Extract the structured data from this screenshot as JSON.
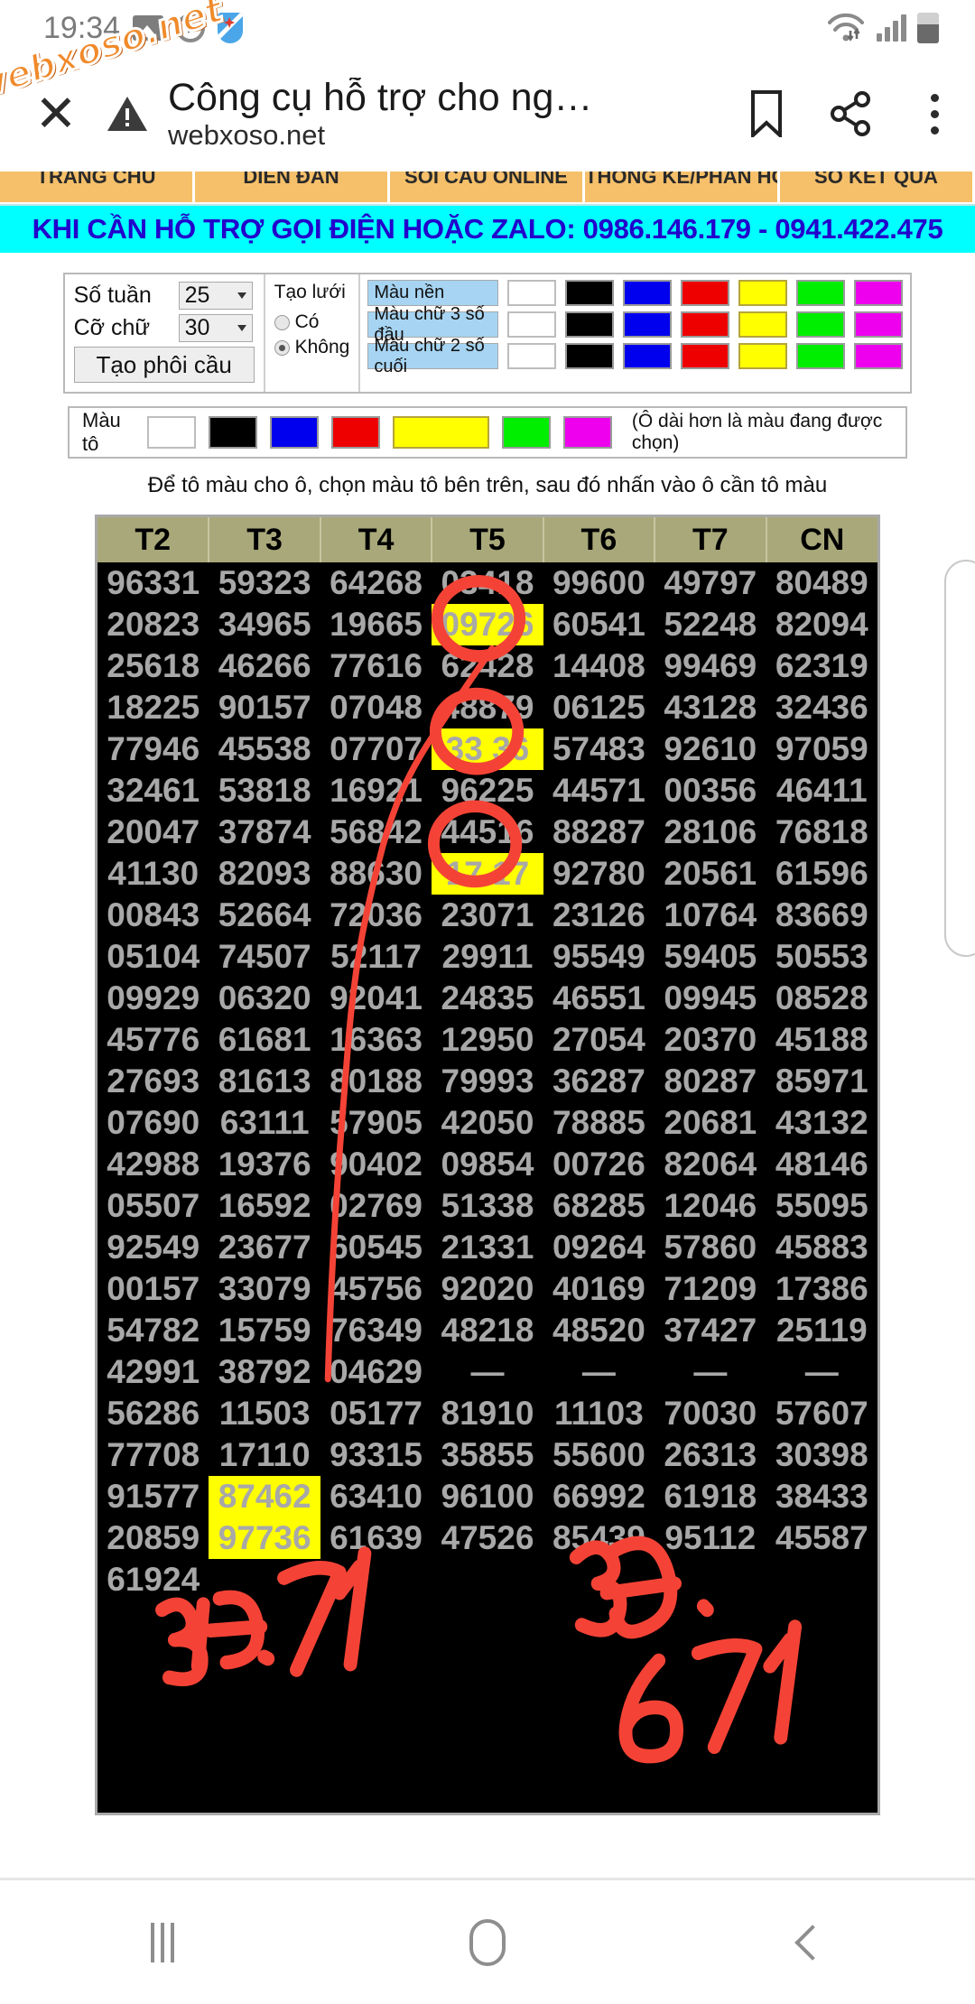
{
  "status_bar": {
    "time": "19:34",
    "left_icons": [
      "image-icon",
      "media-player-icon",
      "shield-icon"
    ],
    "right_icons": [
      "wifi-icon",
      "signal-icon",
      "battery-icon"
    ]
  },
  "browser": {
    "close_label": "✕",
    "security_icon": "warning-triangle-icon",
    "title": "Công cụ hỗ trợ cho ng…",
    "url": "webxoso.net",
    "bookmark_icon": "bookmark-icon",
    "share_icon": "share-icon",
    "more_icon": "more-vertical-icon",
    "watermark": "webxoso.net"
  },
  "site_nav": {
    "items": [
      "TRANG CHỦ",
      "DIỄN ĐÀN",
      "SOI CẦU ONLINE",
      "THỐNG KÊ/PHẢN HỒI",
      "SỔ KẾT QUẢ"
    ]
  },
  "banner": {
    "text": "KHI CẦN HỖ TRỢ GỌI ĐIỆN HOẶC ZALO: 0986.146.179 - 0941.422.475"
  },
  "controls": {
    "weeks_label": "Số tuần",
    "weeks_value": "25",
    "fontsize_label": "Cỡ chữ",
    "fontsize_value": "30",
    "create_button": "Tạo phôi cầu",
    "grid_title": "Tạo lưới",
    "grid_yes": "Có",
    "grid_no": "Không",
    "grid_selected": "Không"
  },
  "color_rows": [
    {
      "label": "Màu nền"
    },
    {
      "label": "Màu chữ 3 số đầu"
    },
    {
      "label": "Màu chữ 2 số cuối"
    }
  ],
  "palette": [
    "#ffffff",
    "#000000",
    "#0000ee",
    "#ee0000",
    "#ffff00",
    "#00ee00",
    "#ee00ee"
  ],
  "fill_row": {
    "label": "Màu tô",
    "note": "(Ô dài hơn là màu đang được chọn)",
    "selected_color": "#ffff00"
  },
  "hint": "Để tô màu cho ô, chọn màu tô bên trên, sau đó nhấn vào ô cần tô màu",
  "table": {
    "headers": [
      "T2",
      "T3",
      "T4",
      "T5",
      "T6",
      "T7",
      "CN"
    ],
    "rows": [
      [
        "96331",
        "59323",
        "64268",
        "03418",
        "99600",
        "49797",
        "80489"
      ],
      [
        "20823",
        "34965",
        "19665",
        "09726",
        "60541",
        "52248",
        "82094"
      ],
      [
        "25618",
        "46266",
        "77616",
        "62428",
        "14408",
        "99469",
        "62319"
      ],
      [
        "18225",
        "90157",
        "07048",
        "48879",
        "06125",
        "43128",
        "32436"
      ],
      [
        "77946",
        "45538",
        "07707",
        "33 36",
        "57483",
        "92610",
        "97059"
      ],
      [
        "32461",
        "53818",
        "16921",
        "96225",
        "44571",
        "00356",
        "46411"
      ],
      [
        "20047",
        "37874",
        "56842",
        "44516",
        "88287",
        "28106",
        "76818"
      ],
      [
        "41130",
        "82093",
        "88630",
        "17 17",
        "92780",
        "20561",
        "61596"
      ],
      [
        "00843",
        "52664",
        "72036",
        "23071",
        "23126",
        "10764",
        "83669"
      ],
      [
        "05104",
        "74507",
        "52117",
        "29911",
        "95549",
        "59405",
        "50553"
      ],
      [
        "09929",
        "06320",
        "92041",
        "24835",
        "46551",
        "09945",
        "08528"
      ],
      [
        "45776",
        "61681",
        "16363",
        "12950",
        "27054",
        "20370",
        "45188"
      ],
      [
        "27693",
        "81613",
        "80188",
        "79993",
        "36287",
        "80287",
        "85971"
      ],
      [
        "07690",
        "63111",
        "57905",
        "42050",
        "78885",
        "20681",
        "43132"
      ],
      [
        "42988",
        "19376",
        "90402",
        "09854",
        "00726",
        "82064",
        "48146"
      ],
      [
        "05507",
        "16592",
        "02769",
        "51338",
        "68285",
        "12046",
        "55095"
      ],
      [
        "92549",
        "23677",
        "60545",
        "21331",
        "09264",
        "57860",
        "45883"
      ],
      [
        "00157",
        "33079",
        "45756",
        "92020",
        "40169",
        "71209",
        "17386"
      ],
      [
        "54782",
        "15759",
        "76349",
        "48218",
        "48520",
        "37427",
        "25119"
      ],
      [
        "42991",
        "38792",
        "04629",
        "—",
        "—",
        "—",
        "—"
      ],
      [
        "56286",
        "11503",
        "05177",
        "81910",
        "11103",
        "70030",
        "57607"
      ],
      [
        "77708",
        "17110",
        "93315",
        "35855",
        "55600",
        "26313",
        "30398"
      ],
      [
        "91577",
        "87462",
        "63410",
        "96100",
        "66992",
        "61918",
        "38433"
      ],
      [
        "20859",
        "97736",
        "61639",
        "47526",
        "85439",
        "95112",
        "45587"
      ],
      [
        "61924",
        "",
        "",
        "",
        "",
        "",
        ""
      ]
    ],
    "highlighted_cells": [
      {
        "row": 1,
        "col": 3,
        "text": "09726",
        "color": "#ffff00"
      },
      {
        "row": 4,
        "col": 3,
        "text": "33 36",
        "color": "#ffff00"
      },
      {
        "row": 7,
        "col": 3,
        "text": "17 17",
        "color": "#ffff00"
      },
      {
        "row": 22,
        "col": 1,
        "text": "87462",
        "color": "#ffff00"
      },
      {
        "row": 23,
        "col": 1,
        "text": "97736",
        "color": "#ffff00"
      }
    ],
    "circled_values": [
      "26",
      "36",
      "17"
    ]
  },
  "handwriting": {
    "left": "BIĐ.71",
    "right_top": "3Đ.",
    "right_bottom": "671"
  },
  "bottom_nav": {
    "recent_label": "recent-apps-icon",
    "home_label": "home-icon",
    "back_label": "back-icon"
  },
  "colors": {
    "banner_bg": "#00ffff",
    "banner_text": "#2200cc",
    "nav_orange": "#f6c06a",
    "table_header_bg": "#a8a87a",
    "table_bg": "#000000",
    "table_text": "#a8a8a8",
    "highlight": "#ffff00",
    "annotation_red": "#f44336"
  }
}
